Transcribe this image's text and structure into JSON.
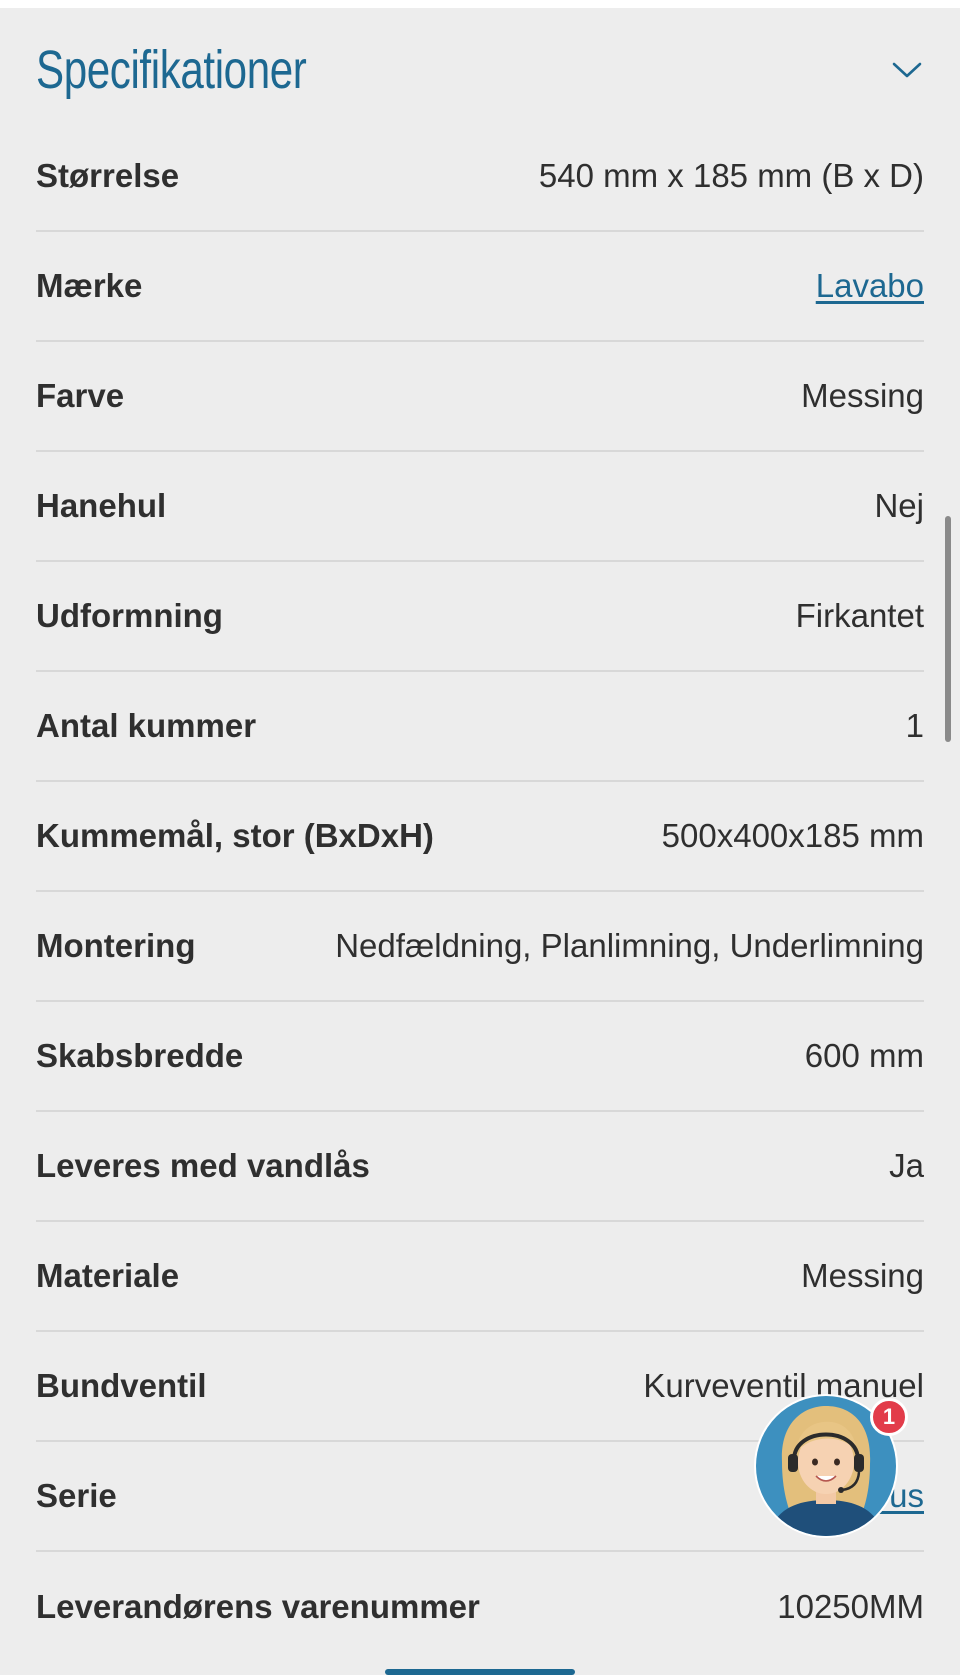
{
  "section": {
    "title": "Specifikationer",
    "toggle_icon": "chevron-down-icon"
  },
  "specs": [
    {
      "label": "Størrelse",
      "value": "540 mm x 185 mm (B x D)",
      "link": false
    },
    {
      "label": "Mærke",
      "value": "Lavabo",
      "link": true
    },
    {
      "label": "Farve",
      "value": "Messing",
      "link": false
    },
    {
      "label": "Hanehul",
      "value": "Nej",
      "link": false
    },
    {
      "label": "Udformning",
      "value": "Firkantet",
      "link": false
    },
    {
      "label": "Antal kummer",
      "value": "1",
      "link": false
    },
    {
      "label": "Kummemål, stor (BxDxH)",
      "value": "500x400x185 mm",
      "link": false
    },
    {
      "label": "Montering",
      "value": "Nedfældning, Planlimning, Underlimning",
      "link": false
    },
    {
      "label": "Skabsbredde",
      "value": "600 mm",
      "link": false
    },
    {
      "label": "Leveres med vandlås",
      "value": "Ja",
      "link": false
    },
    {
      "label": "Materiale",
      "value": "Messing",
      "link": false
    },
    {
      "label": "Bundventil",
      "value": "Kurveventil manuel",
      "link": false
    },
    {
      "label": "Serie",
      "value": "Opus",
      "link": true
    },
    {
      "label": "Leverandørens varenummer",
      "value": "10250MM",
      "link": false
    }
  ],
  "chat": {
    "icon": "support-agent-avatar-icon",
    "badge_count": "1"
  },
  "colors": {
    "accent": "#1d6891",
    "background": "#ededed",
    "text": "#2f2f2f",
    "divider": "#d8d8d8",
    "badge": "#e23c4a"
  }
}
